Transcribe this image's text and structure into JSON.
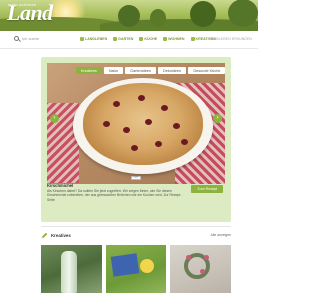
{
  "header": {
    "logo_text": "Land",
    "logo_top": "mein schönes"
  },
  "nav": {
    "search_placeholder": "Ich suche",
    "links": [
      {
        "label": "LANDLEBEN",
        "icon": "house-icon"
      },
      {
        "label": "GARTEN",
        "icon": "flower-icon"
      },
      {
        "label": "KÜCHE",
        "icon": "pot-icon"
      },
      {
        "label": "WOHNEN",
        "icon": "sofa-icon"
      },
      {
        "label": "KREATIVES",
        "icon": "pencil-icon"
      }
    ],
    "right_text": "LANDLEBEN ERKUNDEN"
  },
  "slider": {
    "tabs": [
      "Kreatives",
      "Natur",
      "Gartenideen",
      "Dekoideen",
      "Gesunde Küche"
    ],
    "active_tab": 0,
    "title": "Kirschmichel",
    "text": "Als Kirschen dabei? Da sollten Sie jetzt zugreifen: Wir zeigen Ihnen, wie Sie diesen Kirschmichel zubereiten, der aus gebrauchten Brötchen wie ein Kuchen wird. Zur Rezept-Seite",
    "more_button": "Zum Rezept",
    "pager": "1/5"
  },
  "section": {
    "title": "Kreatives",
    "link": "Alle anzeigen"
  },
  "colors": {
    "accent": "#8db33f",
    "hero_bg": "#dcebc2"
  }
}
